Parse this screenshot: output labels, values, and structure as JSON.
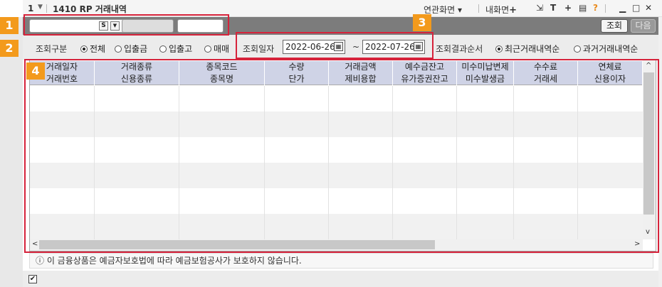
{
  "window": {
    "screen_number": "1",
    "title": "1410 RP 거래내역",
    "linked_screen_label": "연관화면",
    "my_screen_label": "내화면"
  },
  "toolbar": {
    "query_label": "조회",
    "next_label": "다음",
    "s_label": "S"
  },
  "filter": {
    "category_label": "조회구분",
    "options": [
      "전체",
      "입출금",
      "입출고",
      "매매"
    ],
    "selected_option": "전체",
    "date_label": "조회일자",
    "date_from": "2022-06-26",
    "date_sep": "~",
    "date_to": "2022-07-26",
    "order_label": "조회결과순서",
    "order_options": [
      "최근거래내역순",
      "과거거래내역순"
    ],
    "selected_order": "최근거래내역순"
  },
  "grid": {
    "header_row1": [
      "거래일자",
      "거래종류",
      "종목코드",
      "수량",
      "거래금액",
      "예수금잔고",
      "미수미납변제",
      "수수료",
      "연체료"
    ],
    "header_row2": [
      "거래번호",
      "신용종류",
      "종목명",
      "단가",
      "제비용합",
      "유가증권잔고",
      "미수발생금",
      "거래세",
      "신용이자"
    ],
    "rows": []
  },
  "notice": "ⓘ 이 금융상품은 예금자보호법에 따라 예금보험공사가 보호하지 않습니다.",
  "annotations": [
    "1",
    "2",
    "3",
    "4"
  ],
  "colors": {
    "badge": "#f39a1c",
    "highlight": "#d6233b",
    "header_bg": "#cfd3e6",
    "toolbar_bg": "#7c7c7c"
  }
}
